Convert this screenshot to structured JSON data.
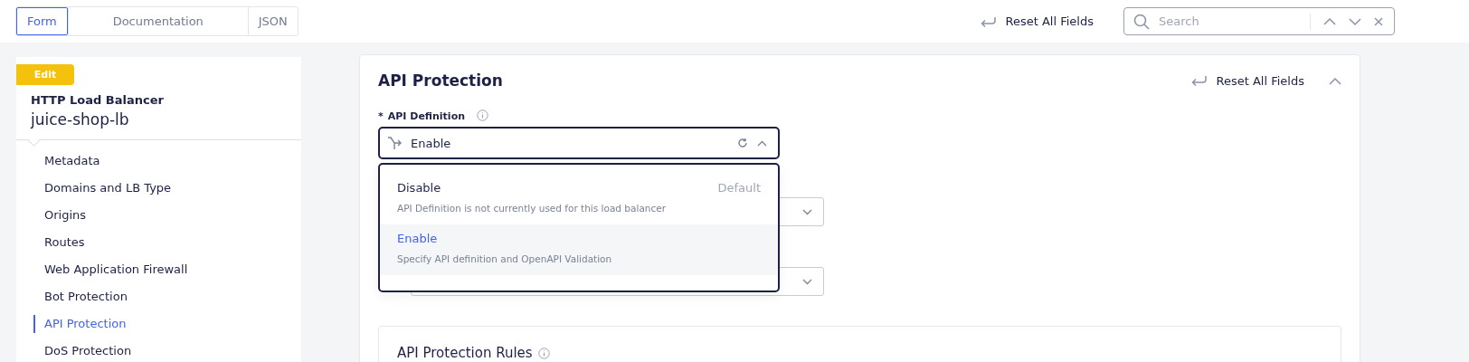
{
  "view_tabs": [
    {
      "label": "Form",
      "selected": true
    },
    {
      "label": "Documentation",
      "selected": false
    },
    {
      "label": "JSON",
      "selected": false
    }
  ],
  "toolbar": {
    "reset_label": "Reset All Fields",
    "search": {
      "placeholder": "Search"
    }
  },
  "sidebar": {
    "badge": "Edit",
    "object_type": "HTTP Load Balancer",
    "object_name": "juice-shop-lb",
    "items": [
      {
        "label": "Metadata",
        "selected": false
      },
      {
        "label": "Domains and LB Type",
        "selected": false
      },
      {
        "label": "Origins",
        "selected": false
      },
      {
        "label": "Routes",
        "selected": false
      },
      {
        "label": "Web Application Firewall",
        "selected": false
      },
      {
        "label": "Bot Protection",
        "selected": false
      },
      {
        "label": "API Protection",
        "selected": true
      },
      {
        "label": "DoS Protection",
        "selected": false
      }
    ]
  },
  "section": {
    "title": "API Protection",
    "reset_label": "Reset All Fields",
    "expanded": true,
    "field": {
      "label": "API Definition",
      "required_mark": "*",
      "value": "Enable",
      "expanded": true,
      "options": [
        {
          "label": "Disable",
          "tag": "Default",
          "description": "API Definition is not currently used for this load balancer",
          "selected": false
        },
        {
          "label": "Enable",
          "description": "Specify API definition and OpenAPI Validation",
          "selected": true
        }
      ]
    },
    "subsection": {
      "title": "API Protection Rules"
    }
  }
}
